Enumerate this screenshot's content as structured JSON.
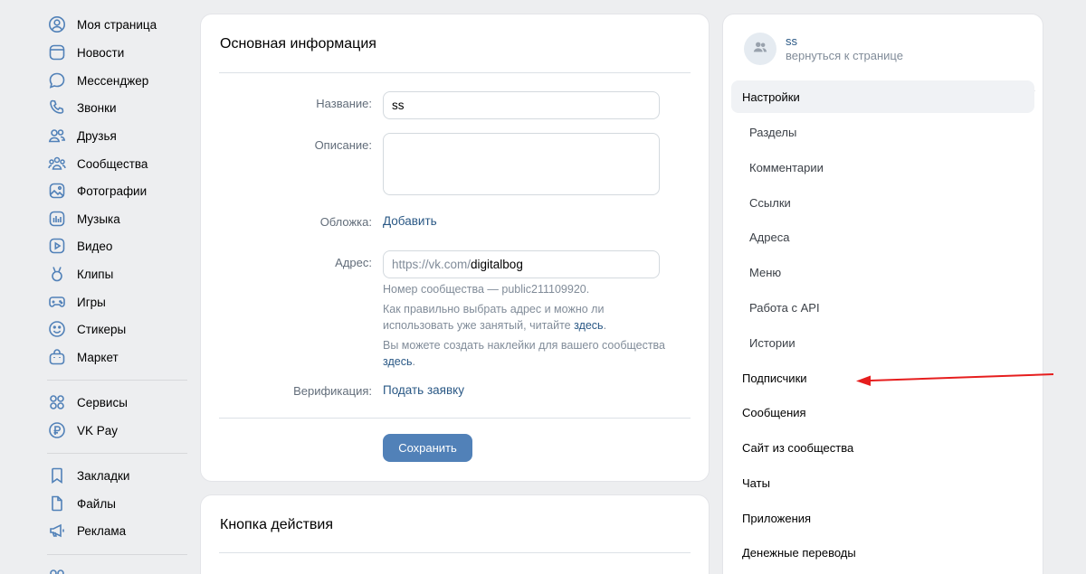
{
  "nav": {
    "items": [
      {
        "label": "Моя страница",
        "icon": "user-circle-icon"
      },
      {
        "label": "Новости",
        "icon": "news-icon"
      },
      {
        "label": "Мессенджер",
        "icon": "chat-bubble-icon"
      },
      {
        "label": "Звонки",
        "icon": "phone-icon"
      },
      {
        "label": "Друзья",
        "icon": "friends-icon"
      },
      {
        "label": "Сообщества",
        "icon": "communities-icon"
      },
      {
        "label": "Фотографии",
        "icon": "photo-icon"
      },
      {
        "label": "Музыка",
        "icon": "music-icon"
      },
      {
        "label": "Видео",
        "icon": "video-icon"
      },
      {
        "label": "Клипы",
        "icon": "clips-icon"
      },
      {
        "label": "Игры",
        "icon": "gamepad-icon"
      },
      {
        "label": "Стикеры",
        "icon": "smile-icon"
      },
      {
        "label": "Маркет",
        "icon": "bag-icon"
      }
    ],
    "group2": [
      {
        "label": "Сервисы",
        "icon": "grid-icon"
      },
      {
        "label": "VK Pay",
        "icon": "ruble-icon"
      }
    ],
    "group3": [
      {
        "label": "Закладки",
        "icon": "bookmark-icon"
      },
      {
        "label": "Файлы",
        "icon": "file-icon"
      },
      {
        "label": "Реклама",
        "icon": "megaphone-icon"
      }
    ]
  },
  "main": {
    "title": "Основная информация",
    "name_label": "Название:",
    "name_value": "ss",
    "description_label": "Описание:",
    "description_value": "",
    "cover_label": "Обложка:",
    "cover_link": "Добавить",
    "address_label": "Адрес:",
    "address_prefix": "https://vk.com/",
    "address_value": "digitalbog",
    "hint_id": "Номер сообщества — public211109920.",
    "hint_choose": "Как правильно выбрать адрес и можно ли использовать уже занятый, читайте ",
    "hint_choose_link": "здесь",
    "hint_stickers": "Вы можете создать наклейки для вашего сообщества ",
    "hint_stickers_link": "здесь",
    "verification_label": "Верификация:",
    "verification_link": "Подать заявку",
    "save_label": "Сохранить"
  },
  "action": {
    "title": "Кнопка действия"
  },
  "community": {
    "name": "ss",
    "back": "вернуться к странице"
  },
  "menu": {
    "settings": "Настройки",
    "sub": [
      "Разделы",
      "Комментарии",
      "Ссылки",
      "Адреса",
      "Меню",
      "Работа с API",
      "Истории"
    ],
    "items": [
      "Подписчики",
      "Сообщения",
      "Сайт из сообщества",
      "Чаты",
      "Приложения",
      "Денежные переводы"
    ]
  },
  "colors": {
    "accent": "#5181b8",
    "link": "#2a5885",
    "arrow": "#e61e1e"
  }
}
